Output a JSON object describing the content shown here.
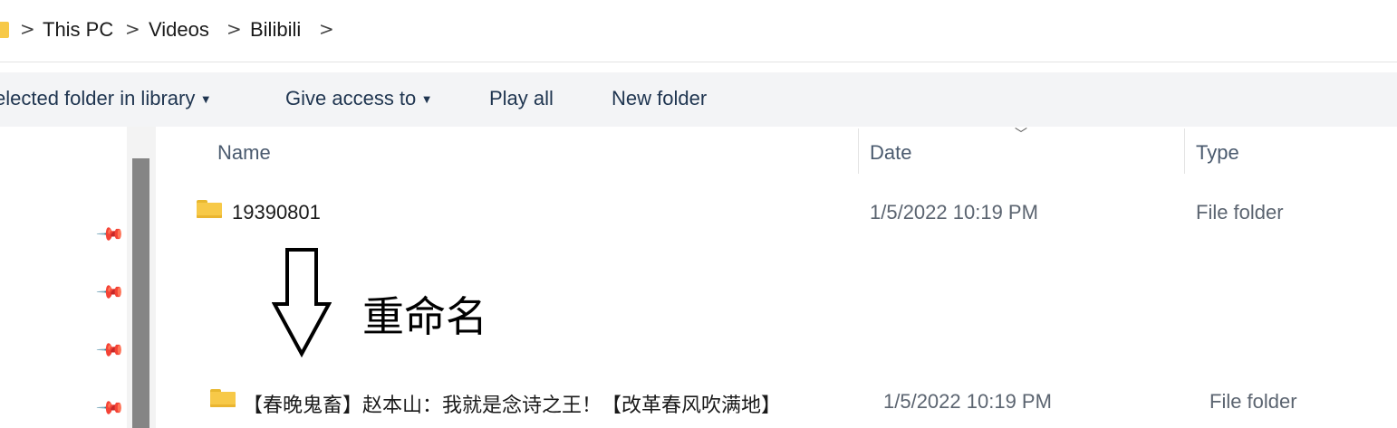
{
  "breadcrumb": {
    "items": [
      "This PC",
      "Videos",
      "Bilibili"
    ],
    "separator": ">"
  },
  "commands": {
    "include_label": "elected folder in library",
    "give_access_label": "Give access to",
    "play_all_label": "Play all",
    "new_folder_label": "New folder"
  },
  "columns": {
    "name": "Name",
    "date": "Date",
    "type": "Type"
  },
  "rows": [
    {
      "name": "19390801",
      "date": "1/5/2022 10:19 PM",
      "type": "File folder"
    },
    {
      "name": "【春晚鬼畜】赵本山：我就是念诗之王！【改革春风吹满地】",
      "date": "1/5/2022 10:19 PM",
      "type": "File folder"
    }
  ],
  "annotation": {
    "text": "重命名"
  },
  "icons": {
    "folder": "folder-icon",
    "pin": "pin-icon",
    "chevron": "chevron-right-icon",
    "arrow": "down-arrow-icon"
  },
  "colors": {
    "folder": "#f7c948",
    "commandbar_bg": "#f3f4f6",
    "command_text": "#1f3550",
    "scroll_thumb": "#858585"
  }
}
